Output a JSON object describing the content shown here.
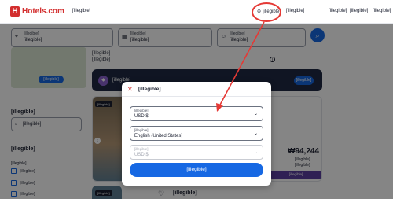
{
  "header": {
    "logo_mark": "H",
    "logo_text": "Hotels.com",
    "nav_left": "[illegible]",
    "language_currency": "[illegible]",
    "nav_items": [
      "[illegible]",
      "[illegible]",
      "[illegible]",
      "[illegible]"
    ]
  },
  "search": {
    "destination_label": "[illegible]",
    "destination_value": "[illegible]",
    "dates_label": "[illegible]",
    "dates_value": "[illegible]",
    "guests_label": "[illegible]",
    "guests_value": "[illegible]"
  },
  "notice": {
    "line1": "[illegible]",
    "line2": "[illegible]",
    "info_icon": "info-icon"
  },
  "map": {
    "button_label": "[illegible]"
  },
  "sidebar": {
    "search_title": "[illegible]",
    "search_placeholder": "[illegible]",
    "filter_title": "[illegible]",
    "filter_subtitle": "[illegible]",
    "filters": [
      "[illegible]",
      "[illegible]",
      "[illegible]"
    ]
  },
  "banner": {
    "text": "[illegible]",
    "button": "[illegible]"
  },
  "listing": {
    "tag": "[illegible]",
    "price": "₩94,244",
    "price_note_1": "[illegible]",
    "price_note_2": "[illegible]",
    "badge": "[illegible]"
  },
  "listing2": {
    "tag": "[illegible]",
    "title": "[illegible]"
  },
  "modal": {
    "title": "[illegible]",
    "region_label": "[illegible]",
    "region_value": "USD $",
    "language_label": "[illegible]",
    "language_value": "English (United States)",
    "currency_label": "[illegible]",
    "currency_value": "USD $",
    "save_label": "[illegible]"
  },
  "colors": {
    "brand_red": "#d32f2f",
    "primary_blue": "#1668e3",
    "annotation_red": "#e53935"
  }
}
